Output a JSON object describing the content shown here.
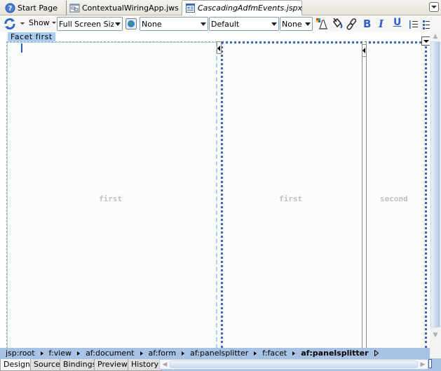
{
  "tabs": [
    {
      "label": "Start Page",
      "icon": "help-icon",
      "active": false
    },
    {
      "label": "ContextualWiringApp.jws",
      "icon": "workspace-icon",
      "active": false
    },
    {
      "label": "CascadingAdfmEvents.jspx",
      "icon": "jspx-page-icon",
      "active": true
    }
  ],
  "toolbar": {
    "show_label": "Show",
    "screen_size": "Full Screen Size",
    "style_class": "None",
    "font": "Default",
    "size": "None",
    "icons": [
      "refresh-icon",
      "preview-browser-icon",
      "font-color-icon",
      "fill-color-icon",
      "link-icon",
      "bold-icon",
      "italic-icon",
      "underline-icon",
      "ordered-list-icon",
      "unordered-list-icon"
    ]
  },
  "editor": {
    "facet_label": "Facet  first",
    "panels": [
      {
        "placeholder": "first"
      },
      {
        "placeholder": "first"
      },
      {
        "placeholder": "second"
      }
    ]
  },
  "breadcrumb": [
    {
      "label": "jsp:root"
    },
    {
      "label": "f:view"
    },
    {
      "label": "af:document"
    },
    {
      "label": "af:form"
    },
    {
      "label": "af:panelsplitter"
    },
    {
      "label": "f:facet"
    },
    {
      "label": "af:panelsplitter",
      "active": true
    }
  ],
  "bottom_tabs": [
    {
      "label": "Design",
      "active": true
    },
    {
      "label": "Source"
    },
    {
      "label": "Bindings"
    },
    {
      "label": "Preview"
    },
    {
      "label": "History"
    }
  ]
}
